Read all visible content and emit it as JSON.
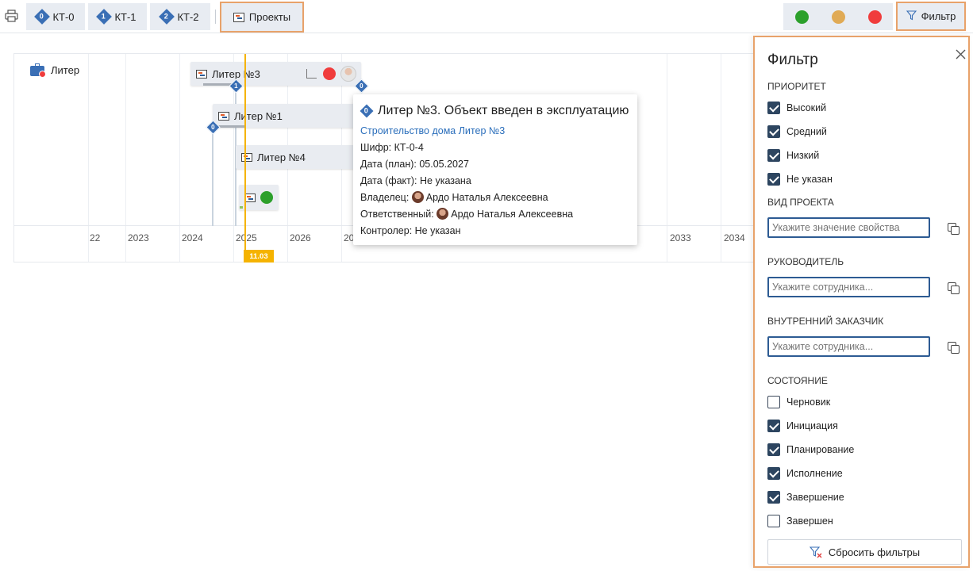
{
  "toolbar": {
    "kt0": {
      "num": "0",
      "label": "КТ-0"
    },
    "kt1": {
      "num": "1",
      "label": "КТ-1"
    },
    "kt2": {
      "num": "2",
      "label": "КТ-2"
    },
    "projects_label": "Проекты",
    "filter_label": "Фильтр",
    "status_colors": [
      "#2ca02c",
      "#e0aa55",
      "#f03c3c"
    ]
  },
  "gantt": {
    "row_label": "Литер",
    "years": [
      "22",
      "2023",
      "2024",
      "2025",
      "2026",
      "20",
      "2033",
      "2034"
    ],
    "today_label": "11.03",
    "bars": [
      {
        "label": "Литер №3"
      },
      {
        "label": "Литер №1"
      },
      {
        "label": "Литер №4"
      }
    ],
    "milestones": [
      "1",
      "0",
      "0"
    ]
  },
  "tooltip": {
    "num": "0",
    "title": "Литер №3. Объект введен в эксплуатацию",
    "link": "Строительство дома Литер №3",
    "code": "Шифр: КТ-0-4",
    "plan": "Дата (план): 05.05.2027",
    "fact": "Дата (факт): Не указана",
    "owner_label": "Владелец:",
    "owner": "Ардо Наталья Алексеевна",
    "resp_label": "Ответственный:",
    "resp": "Ардо Наталья Алексеевна",
    "controller": "Контролер: Не указан"
  },
  "filter": {
    "title": "Фильтр",
    "priority_title": "ПРИОРИТЕТ",
    "priority": [
      {
        "label": "Высокий",
        "checked": true
      },
      {
        "label": "Средний",
        "checked": true
      },
      {
        "label": "Низкий",
        "checked": true
      },
      {
        "label": "Не указан",
        "checked": true
      }
    ],
    "project_type_title": "ВИД ПРОЕКТА",
    "project_type_placeholder": "Укажите значение свойства",
    "manager_title": "РУКОВОДИТЕЛЬ",
    "manager_placeholder": "Укажите сотрудника...",
    "customer_title": "ВНУТРЕННИЙ ЗАКАЗЧИК",
    "customer_placeholder": "Укажите сотрудника...",
    "state_title": "СОСТОЯНИЕ",
    "states": [
      {
        "label": "Черновик",
        "checked": false
      },
      {
        "label": "Инициация",
        "checked": true
      },
      {
        "label": "Планирование",
        "checked": true
      },
      {
        "label": "Исполнение",
        "checked": true
      },
      {
        "label": "Завершение",
        "checked": true
      },
      {
        "label": "Завершен",
        "checked": false
      }
    ],
    "reset_label": "Сбросить фильтры"
  }
}
